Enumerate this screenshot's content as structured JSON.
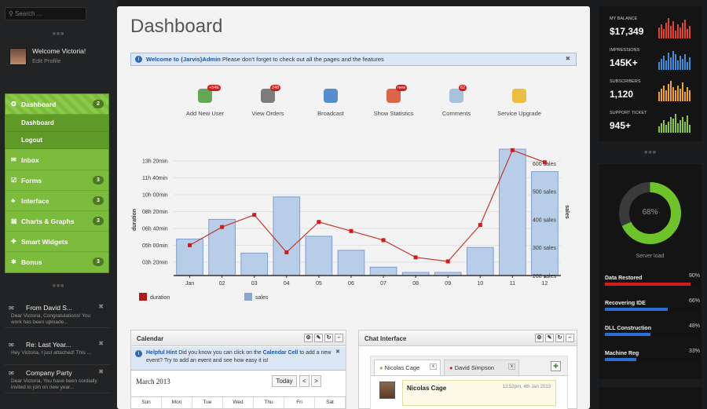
{
  "sidebar": {
    "search_placeholder": "Search ...",
    "user": {
      "welcome": "Welcome Victoria!",
      "edit": "Edit Profile"
    },
    "nav": [
      {
        "label": "Dashboard",
        "badge": "2",
        "icon": "gauge-icon",
        "sub": [
          {
            "label": "Dashboard"
          },
          {
            "label": "Logout"
          }
        ]
      },
      {
        "label": "Inbox",
        "badge": "",
        "icon": "mail-icon"
      },
      {
        "label": "Forms",
        "badge": "3",
        "icon": "checkbox-icon"
      },
      {
        "label": "Interface",
        "badge": "3",
        "icon": "flask-icon"
      },
      {
        "label": "Charts & Graphs",
        "badge": "3",
        "icon": "chart-icon"
      },
      {
        "label": "Smart Widgets",
        "badge": "",
        "icon": "plus-icon"
      },
      {
        "label": "Bonus",
        "badge": "3",
        "icon": "gear-icon"
      }
    ],
    "messages": [
      {
        "title": "From David S...",
        "body": "Dear Victoria, Congratulations! You work has been uploade...",
        "icon": "envelope-icon"
      },
      {
        "title": "Re: Last Year...",
        "body": "Hey Victoria, I just attached! This ...",
        "icon": "envelope-icon"
      },
      {
        "title": "Company Party",
        "body": "Dear Victoria, You have been cordially invited to join on new year...",
        "icon": "envelope-icon"
      }
    ]
  },
  "main": {
    "title": "Dashboard",
    "alert": {
      "strong": "Welcome to {Jarvis}Admin",
      "text": "Please don't forget to check out all the pages and the features"
    },
    "shortcuts": [
      {
        "label": "Add New User",
        "badge": "+54E",
        "icon": "add-user-icon",
        "color": "#4a9a3a"
      },
      {
        "label": "View Orders",
        "badge": "248",
        "icon": "orders-icon",
        "color": "#666"
      },
      {
        "label": "Broadcast",
        "badge": "",
        "icon": "broadcast-icon",
        "color": "#3a7ac8"
      },
      {
        "label": "Show Statistics",
        "badge": "new",
        "icon": "statistics-icon",
        "color": "#d84a2a"
      },
      {
        "label": "Comments",
        "badge": "62",
        "icon": "comments-icon",
        "color": "#9ab8d8"
      },
      {
        "label": "Service Upgrade",
        "badge": "",
        "icon": "upgrade-icon",
        "color": "#e8b520"
      }
    ],
    "calendar": {
      "title": "Calendar",
      "hint_label": "Helpful Hint",
      "hint_a": "Did you know you can click on the",
      "hint_link": "Calendar Cell",
      "hint_b": "to add a new event? Try to add an event and see how easy it is!",
      "month": "March 2013",
      "today": "Today",
      "prev": "<",
      "next": ">",
      "days": [
        "Sun",
        "Mon",
        "Tue",
        "Wed",
        "Thu",
        "Fri",
        "Sat"
      ]
    },
    "chat": {
      "title": "Chat Interface",
      "tabs": [
        {
          "label": "Nicolas Cage"
        },
        {
          "label": "David Simpson"
        }
      ],
      "name": "Nicolas Cage",
      "time": "12:52pm, 4th Jan 2013"
    }
  },
  "chart_data": {
    "type": "bar",
    "categories": [
      "Jan",
      "02",
      "03",
      "04",
      "05",
      "06",
      "07",
      "08",
      "09",
      "10",
      "11",
      "12"
    ],
    "series": [
      {
        "name": "duration",
        "type": "line",
        "axis": "left",
        "values": [
          5.0,
          6.8,
          8.0,
          4.3,
          7.3,
          6.4,
          5.5,
          3.8,
          3.4,
          7.0,
          14.4,
          13.2
        ]
      },
      {
        "name": "sales",
        "type": "bar",
        "axis": "right",
        "values": [
          330,
          400,
          280,
          480,
          340,
          290,
          230,
          80,
          50,
          300,
          650,
          570
        ]
      }
    ],
    "ylabel": "duration",
    "y2label": "sales",
    "yticks": [
      "03h 20min",
      "05h 00min",
      "06h 40min",
      "08h 20min",
      "10h 00min",
      "11h 40min",
      "13h 20min"
    ],
    "y2ticks": [
      "200 sales",
      "300 sales",
      "400 sales",
      "500 sales",
      "600 sales"
    ],
    "legend_position": "bottom-left"
  },
  "stats": [
    {
      "label": "MY BALANCE",
      "value": "$17,349",
      "color": "#e8432a"
    },
    {
      "label": "IMPRESSIONS",
      "value": "145K+",
      "color": "#3b8fe0"
    },
    {
      "label": "SUBSCRIBERS",
      "value": "1,120",
      "color": "#f2a41c"
    },
    {
      "label": "SUPPORT TICKET",
      "value": "945+",
      "color": "#8cc63a"
    }
  ],
  "server": {
    "percent": "68%",
    "label": "Server load",
    "value": 0.68
  },
  "progress": [
    {
      "label": "Data Restored",
      "percent": "90%",
      "value": 0.9,
      "color": "#d21c1c"
    },
    {
      "label": "Recovering IDE",
      "percent": "66%",
      "value": 0.66,
      "color": "#2a6fd6"
    },
    {
      "label": "DLL Construction",
      "percent": "48%",
      "value": 0.48,
      "color": "#2a6fd6"
    },
    {
      "label": "Machine Reg",
      "percent": "33%",
      "value": 0.33,
      "color": "#2a6fd6"
    }
  ]
}
